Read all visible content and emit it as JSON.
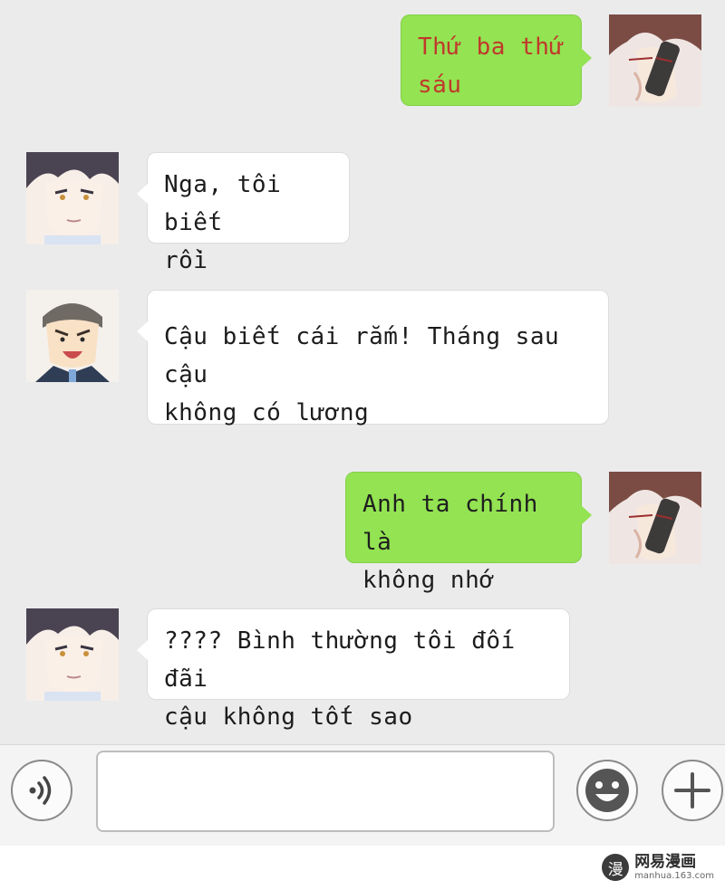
{
  "messages": [
    {
      "side": "right",
      "speaker": "glasses-man",
      "lines": [
        "Thứ ba thứ",
        "sáu"
      ],
      "color": "#c0392b"
    },
    {
      "side": "left",
      "speaker": "dark-hair-man",
      "lines": [
        "Nga, tôi biết",
        "rồi"
      ]
    },
    {
      "side": "left",
      "speaker": "angry-boss",
      "lines": [
        "Cậu biết cái rắm! Tháng sau cậu",
        "không có lương"
      ]
    },
    {
      "side": "right",
      "speaker": "glasses-man",
      "lines": [
        "Anh ta chính là",
        "không nhớ"
      ]
    },
    {
      "side": "left",
      "speaker": "dark-hair-man",
      "lines": [
        "???? Bình thường tôi đối đãi",
        "cậu không tốt sao"
      ]
    }
  ],
  "input_bar": {
    "voice_icon": "voice-icon",
    "emoji_icon": "emoji-icon",
    "add_icon": "plus-icon"
  },
  "watermark": {
    "logo_char": "漫",
    "title": "网易漫画",
    "url": "manhua.163.com"
  }
}
